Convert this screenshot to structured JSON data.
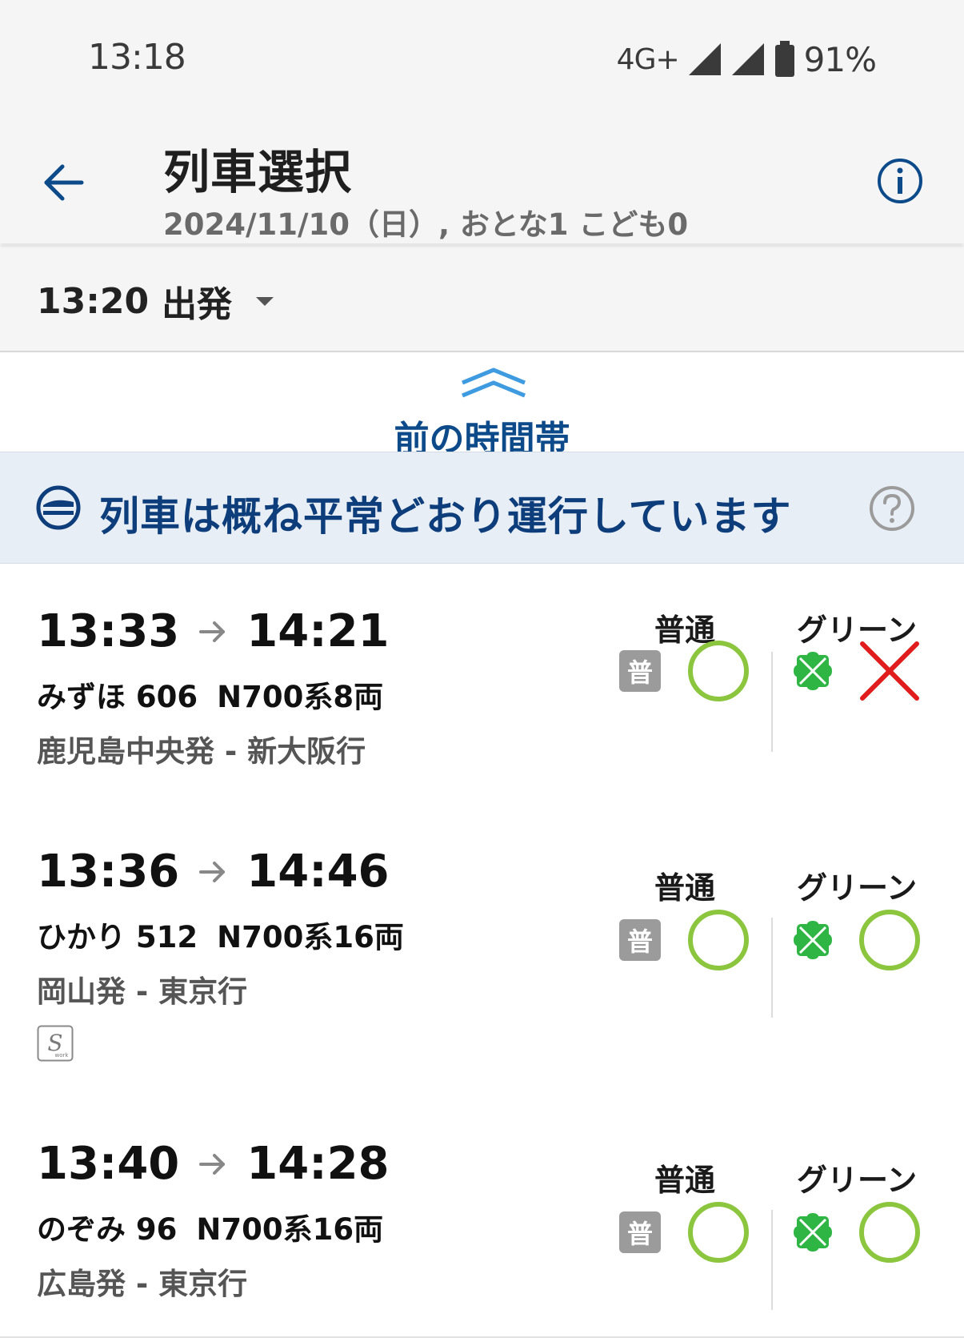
{
  "status_bar": {
    "time": "13:18",
    "network": "4G+",
    "battery": "91%"
  },
  "app_bar": {
    "title": "列車選択",
    "subtitle": "2024/11/10（日）, おとな1 こども0"
  },
  "time_selector": {
    "time": "13:20",
    "label": "出発"
  },
  "prev_period": {
    "label": "前の時間帯"
  },
  "service_banner": {
    "text": "列車は概ね平常どおり運行しています"
  },
  "columns": {
    "ordinary": "普通",
    "green": "グリーン",
    "ordinary_badge": "普"
  },
  "colors": {
    "accent": "#0d4a8a",
    "available": "#8cc63f",
    "unavailable": "#e11c1c",
    "green_car": "#2fb544"
  },
  "trains": [
    {
      "depart": "13:33",
      "arrive": "14:21",
      "train": "みずほ 606",
      "car_type": "N700系8両",
      "route": "鹿児島中央発 - 新大阪行",
      "ordinary_status": "available",
      "green_status": "unavailable",
      "sworkable": false
    },
    {
      "depart": "13:36",
      "arrive": "14:46",
      "train": "ひかり 512",
      "car_type": "N700系16両",
      "route": "岡山発 - 東京行",
      "ordinary_status": "available",
      "green_status": "available",
      "sworkable": true
    },
    {
      "depart": "13:40",
      "arrive": "14:28",
      "train": "のぞみ 96",
      "car_type": "N700系16両",
      "route": "広島発 - 東京行",
      "ordinary_status": "available",
      "green_status": "available",
      "sworkable": false
    }
  ]
}
